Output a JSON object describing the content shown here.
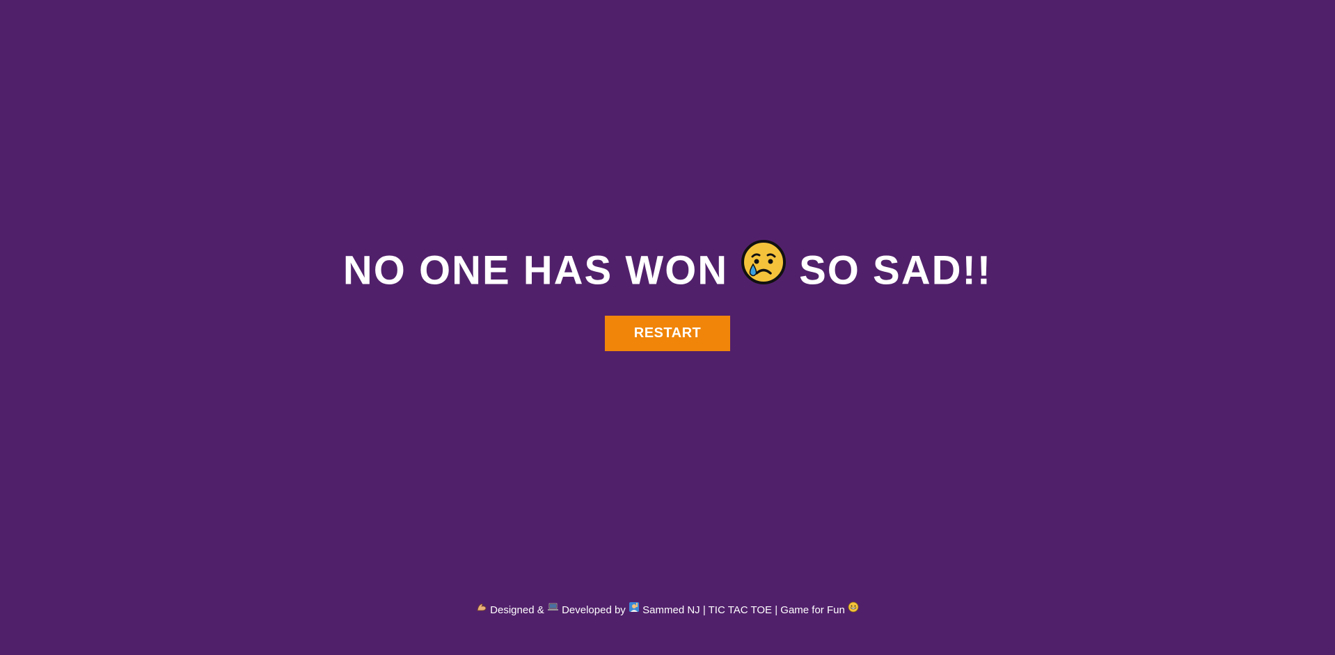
{
  "result": {
    "text_before": "NO ONE HAS WON",
    "text_after": "SO SAD!!",
    "emoji_icon": "crying-face-icon"
  },
  "restart_button": {
    "label": "RESTART"
  },
  "footer": {
    "designed": "Designed &",
    "developed": "Developed by",
    "author": "Sammed NJ | TIC TAC TOE | Game for Fun",
    "icons": [
      "flexed-biceps-icon",
      "laptop-icon",
      "person-raising-hand-icon",
      "grinning-face-icon"
    ]
  },
  "colors": {
    "background": "#51206b",
    "button": "#f0850a",
    "text": "#ffffff"
  }
}
